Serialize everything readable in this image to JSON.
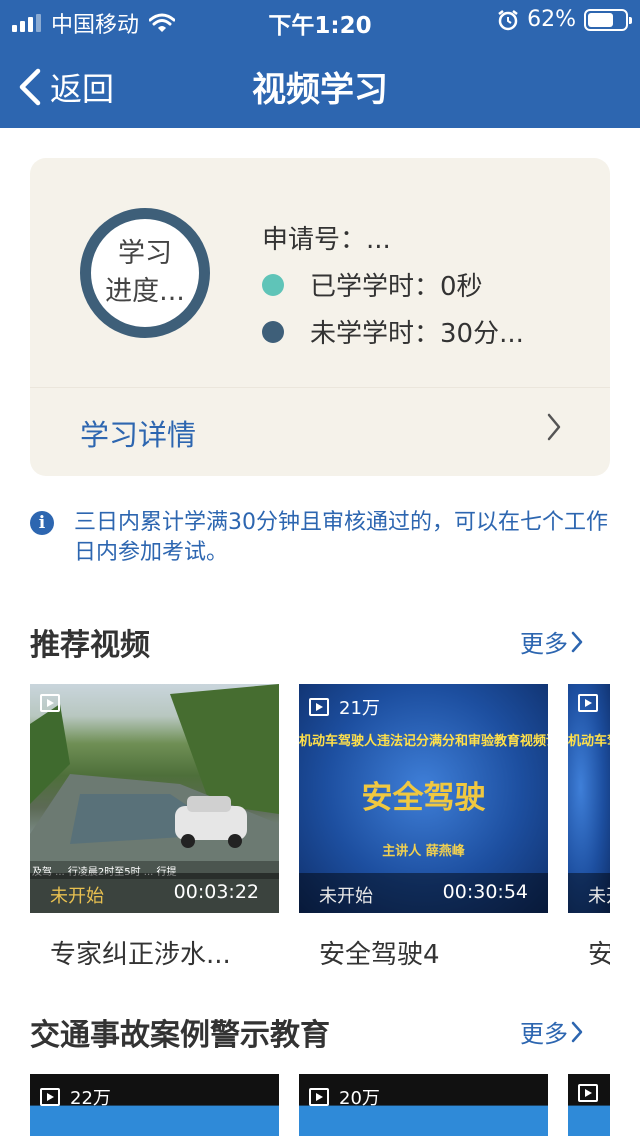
{
  "status_bar": {
    "carrier": "中国移动",
    "time": "下午1:20",
    "battery": "62%",
    "battery_level": 0.62
  },
  "nav": {
    "back_label": "返回",
    "title": "视频学习"
  },
  "progress_card": {
    "ring_line1": "学习",
    "ring_line2": "进度...",
    "apply_label": "申请号：...",
    "studied_label": "已学学时：0秒",
    "remaining_label": "未学学时：30分...",
    "detail_label": "学习详情",
    "colors": {
      "studied": "#5fc4b8",
      "remaining": "#3e5f79"
    }
  },
  "notice": {
    "text": "三日内累计学满30分钟且审核通过的，可以在七个工作日内参加考试。"
  },
  "sections": [
    {
      "title": "推荐视频",
      "more": "更多",
      "videos": [
        {
          "title": "专家纠正涉水...",
          "status": "未开始",
          "duration": "00:03:22",
          "views": "",
          "subtitle_strip": "及驾 ... 行凌晨2时至5时 ... 行提"
        },
        {
          "title": "安全驾驶4",
          "status": "未开始",
          "duration": "00:30:54",
          "views": "21万",
          "banner_top": "机动车驾驶人违法记分满分和审验教育视频课件",
          "banner_main": "安全驾驶",
          "banner_speaker": "主讲人 薛燕峰"
        },
        {
          "title": "安",
          "status": "未开",
          "duration": "",
          "views": "",
          "banner_top": "机动车驾"
        }
      ]
    },
    {
      "title": "交通事故案例警示教育",
      "more": "更多",
      "videos": [
        {
          "views": "22万"
        },
        {
          "views": "20万"
        },
        {
          "views": ""
        }
      ]
    }
  ]
}
